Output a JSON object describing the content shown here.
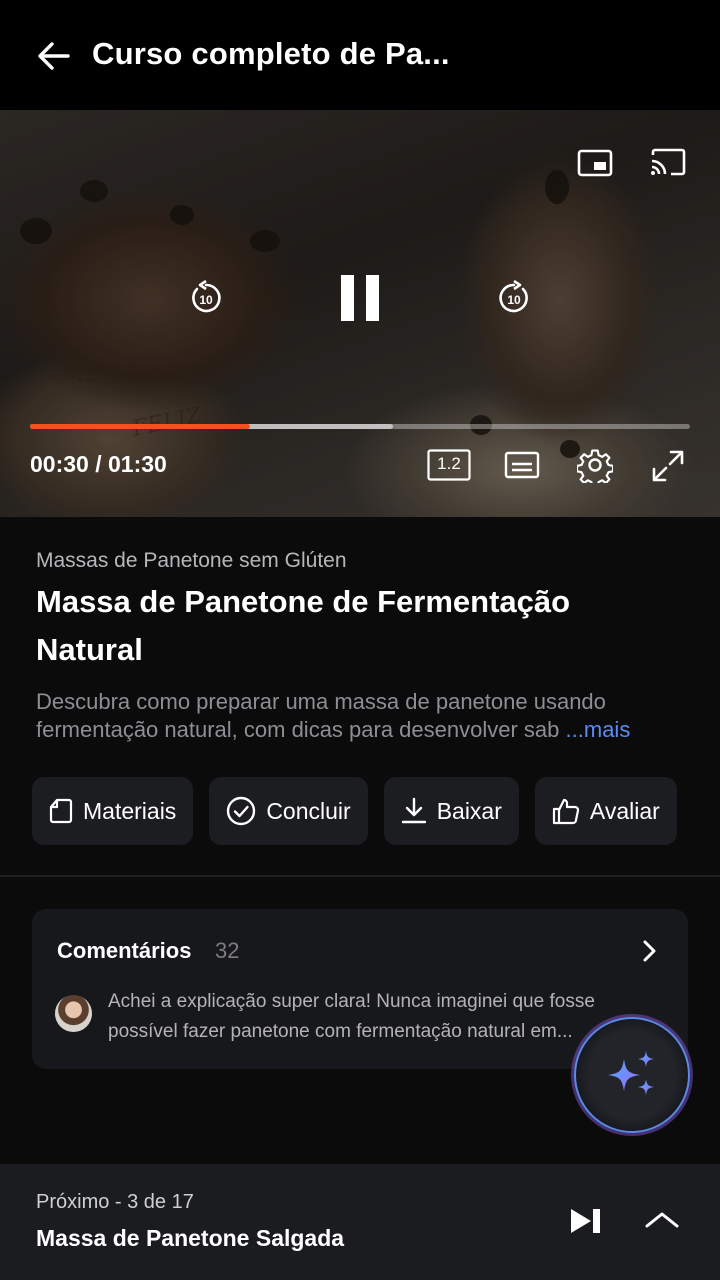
{
  "header": {
    "title": "Curso completo de Pa..."
  },
  "player": {
    "time": "00:30 / 01:30",
    "progress": 0.333,
    "buffered": 0.55,
    "speed": "1.2",
    "packaging_text_1": "MEU RISO",
    "packaging_text_2": "FELIZ"
  },
  "lesson": {
    "module": "Massas de Panetone sem Glúten",
    "title": "Massa de Panetone de Fermentação Natural",
    "description": "Descubra como preparar uma massa de panetone usando fermentação natural, com dicas para desenvolver sab",
    "more": "...mais"
  },
  "actions": [
    {
      "label": "Materiais",
      "icon": "document-icon"
    },
    {
      "label": "Concluir",
      "icon": "check-circle-icon"
    },
    {
      "label": "Baixar",
      "icon": "download-icon"
    },
    {
      "label": "Avaliar",
      "icon": "thumbs-up-icon"
    }
  ],
  "comments": {
    "title": "Comentários",
    "count": "32",
    "preview": "Achei a explicação super clara! Nunca imaginei que fosse possível fazer panetone com fermentação natural em..."
  },
  "next": {
    "label": "Próximo - 3 de 17",
    "title": "Massa de Panetone Salgada"
  },
  "colors": {
    "accent": "#f4511e",
    "link": "#5b8cf5",
    "ai_gradient": "#8e5cec"
  }
}
